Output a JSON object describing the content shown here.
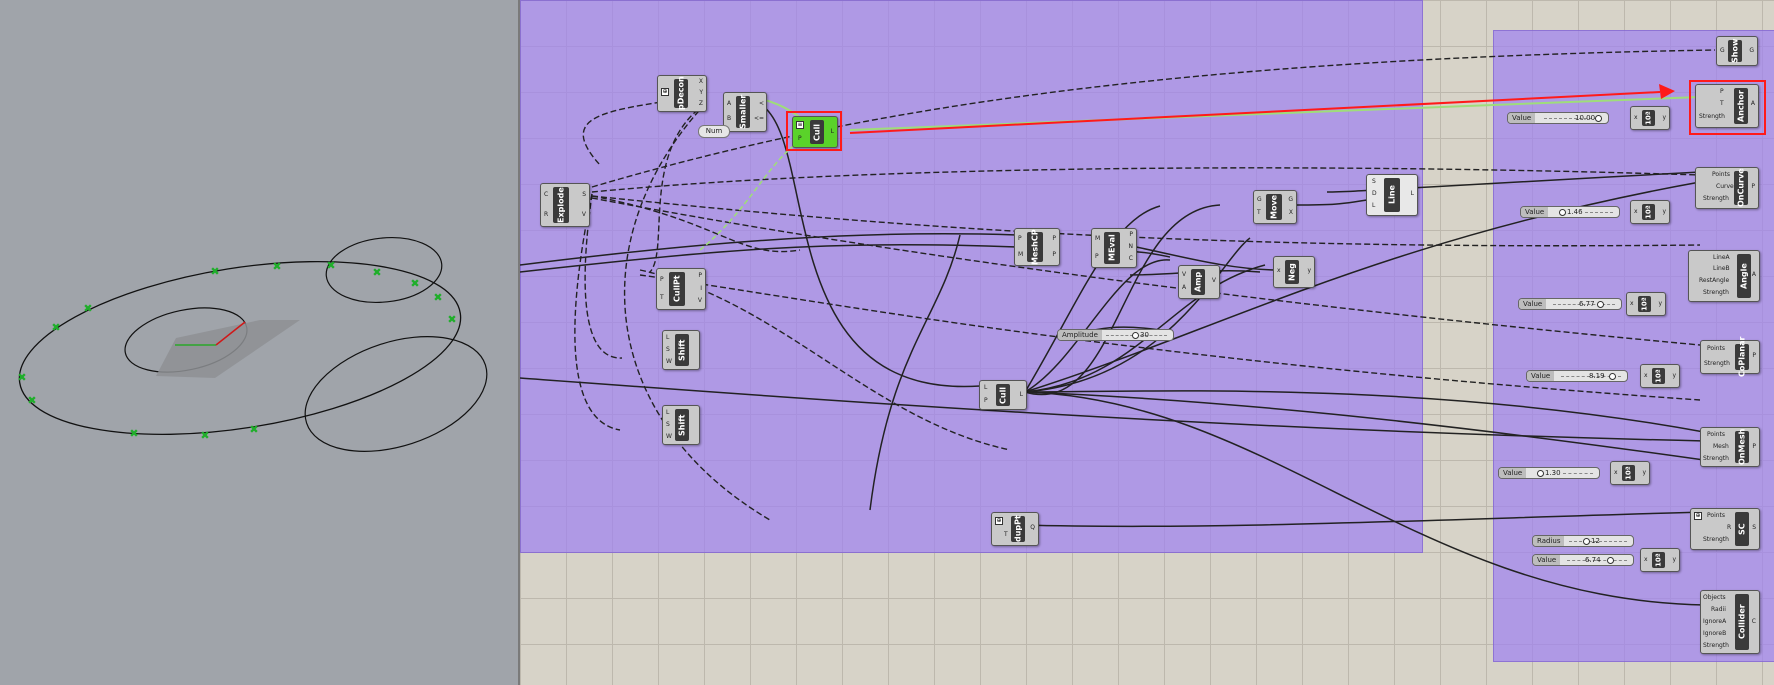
{
  "nodes": {
    "pdecon": {
      "title": "pDecon",
      "inputs": [
        "P"
      ],
      "outputs": [
        "X",
        "Y",
        "Z"
      ]
    },
    "smaller": {
      "title": "Smaller",
      "inputs": [
        "A",
        "B"
      ],
      "outputs": [
        "<",
        "<="
      ]
    },
    "num": {
      "title": "Num"
    },
    "cull_top": {
      "title": "Cull",
      "inputs": [
        "L",
        "P"
      ],
      "outputs": [
        "L"
      ]
    },
    "explode": {
      "title": "Explode",
      "inputs": [
        "C",
        "R"
      ],
      "outputs": [
        "S",
        "V"
      ]
    },
    "cullpt": {
      "title": "CullPt",
      "inputs": [
        "P",
        "T"
      ],
      "outputs": [
        "P",
        "I",
        "V"
      ]
    },
    "shift1": {
      "title": "Shift",
      "inputs": [
        "L",
        "S",
        "W"
      ],
      "outputs": [
        ""
      ]
    },
    "shift2": {
      "title": "Shift",
      "inputs": [
        "L",
        "S",
        "W"
      ],
      "outputs": [
        ""
      ]
    },
    "meshcp": {
      "title": "MeshCP",
      "inputs": [
        "P",
        "M"
      ],
      "outputs": [
        "P",
        "P"
      ]
    },
    "meval": {
      "title": "MEval",
      "inputs": [
        "M",
        "P"
      ],
      "outputs": [
        "P",
        "N",
        "C"
      ]
    },
    "move": {
      "title": "Move",
      "inputs": [
        "G",
        "T"
      ],
      "outputs": [
        "G",
        "X"
      ]
    },
    "line": {
      "title": "Line",
      "inputs": [
        "S",
        "D",
        "L"
      ],
      "outputs": [
        "L"
      ]
    },
    "amp": {
      "title": "Amp",
      "inputs": [
        "V",
        "A"
      ],
      "outputs": [
        "V"
      ]
    },
    "neg": {
      "title": "Neg",
      "inputs": [
        "x"
      ],
      "outputs": [
        "y"
      ]
    },
    "cull_mid": {
      "title": "Cull",
      "inputs": [
        "L",
        "P"
      ],
      "outputs": [
        "L"
      ]
    },
    "duppt": {
      "title": "dupPt",
      "inputs": [
        "P",
        "T"
      ],
      "outputs": [
        "Q"
      ]
    },
    "show": {
      "title": "Show",
      "inputs": [
        "G"
      ],
      "outputs": [
        "G"
      ]
    },
    "anchor": {
      "title": "Anchor",
      "inputs": [
        "P",
        "T",
        "Strength"
      ],
      "outputs": [
        "A"
      ]
    },
    "oncurve": {
      "title": "OnCurve",
      "inputs": [
        "Points",
        "Curve",
        "Strength"
      ],
      "outputs": [
        "P"
      ]
    },
    "angle": {
      "title": "Angle",
      "inputs": [
        "LineA",
        "LineB",
        "RestAngle",
        "Strength"
      ],
      "outputs": [
        "A"
      ]
    },
    "coplanar": {
      "title": "CoPlanar",
      "inputs": [
        "Points",
        "Strength"
      ],
      "outputs": [
        "P"
      ]
    },
    "onmesh": {
      "title": "OnMesh",
      "inputs": [
        "Points",
        "Mesh",
        "Strength"
      ],
      "outputs": [
        "P"
      ]
    },
    "sc": {
      "title": "SC",
      "inputs": [
        "Points",
        "R",
        "Strength"
      ],
      "outputs": [
        "S"
      ]
    },
    "collider": {
      "title": "Collider",
      "inputs": [
        "Objects",
        "Radii",
        "IgnoreA",
        "IgnoreB",
        "Strength"
      ],
      "outputs": [
        "C"
      ]
    },
    "pow1": {
      "title": "10ª",
      "inputs": [
        "x"
      ],
      "outputs": [
        "y"
      ]
    },
    "pow2": {
      "title": "10ª",
      "inputs": [
        "x"
      ],
      "outputs": [
        "y"
      ]
    },
    "pow3": {
      "title": "10ª",
      "inputs": [
        "x"
      ],
      "outputs": [
        "y"
      ]
    },
    "pow4": {
      "title": "10ª",
      "inputs": [
        "x"
      ],
      "outputs": [
        "y"
      ]
    },
    "pow5": {
      "title": "10ª",
      "inputs": [
        "x"
      ],
      "outputs": [
        "y"
      ]
    },
    "pow6": {
      "title": "10ª",
      "inputs": [
        "x"
      ],
      "outputs": [
        "y"
      ]
    }
  },
  "sliders": {
    "amplitude": {
      "label": "Amplitude",
      "value": "30"
    },
    "v1": {
      "label": "Value",
      "value": "10.00"
    },
    "v2": {
      "label": "Value",
      "value": "1.46"
    },
    "v3": {
      "label": "Value",
      "value": "6.77"
    },
    "v4": {
      "label": "Value",
      "value": "8.19"
    },
    "v5": {
      "label": "Value",
      "value": "1.30"
    },
    "radius": {
      "label": "Radius",
      "value": "12"
    },
    "v6": {
      "label": "Value",
      "value": "6.74"
    }
  },
  "colors": {
    "group": "#a886f2",
    "highlight": "#ff1a1a",
    "cull_active": "#5ad22a",
    "viewport": "#a0a4aa"
  }
}
